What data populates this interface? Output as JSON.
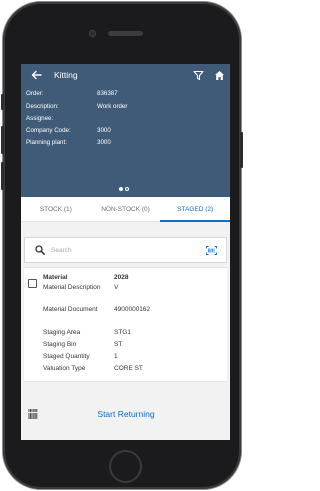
{
  "app": {
    "title": "Kitting"
  },
  "header": {
    "rows": [
      {
        "label": "Order:",
        "value": "836387"
      },
      {
        "label": "Description:",
        "value": "Work order"
      },
      {
        "label": "Assignee:",
        "value": ""
      },
      {
        "label": "Company Code:",
        "value": "3000"
      },
      {
        "label": "Planning plant:",
        "value": "3000"
      }
    ],
    "page_indicator": {
      "count": 2,
      "active": 1
    }
  },
  "tabs": [
    {
      "label": "STOCK (1)",
      "active": false
    },
    {
      "label": "NON-STOCK (0)",
      "active": false
    },
    {
      "label": "STAGED (2)",
      "active": true
    }
  ],
  "search": {
    "placeholder": "Search",
    "value": ""
  },
  "item": {
    "checked": false,
    "fields": [
      {
        "label": "Material",
        "value": "2028",
        "bold": true
      },
      {
        "label": "Material Description",
        "value": "V",
        "bold": false
      },
      {
        "label": "Material Document",
        "value": "4900000162",
        "bold": false
      },
      {
        "label": "Staging Area",
        "value": "STG1",
        "bold": false
      },
      {
        "label": "Staging Bin",
        "value": "ST",
        "bold": false
      },
      {
        "label": "Staged Quantity",
        "value": "1",
        "bold": false
      },
      {
        "label": "Valuation Type",
        "value": "CORE ST",
        "bold": false
      }
    ]
  },
  "footer": {
    "action_label": "Start Returning"
  },
  "colors": {
    "header_bg": "#3f5b78",
    "accent": "#0a6ed1",
    "page_bg": "#f2f2f2"
  },
  "icons": {
    "back": "back-arrow-icon",
    "filter": "filter-icon",
    "home": "home-icon",
    "search": "search-icon",
    "scan": "scan-icon",
    "barcode": "barcode-icon"
  }
}
